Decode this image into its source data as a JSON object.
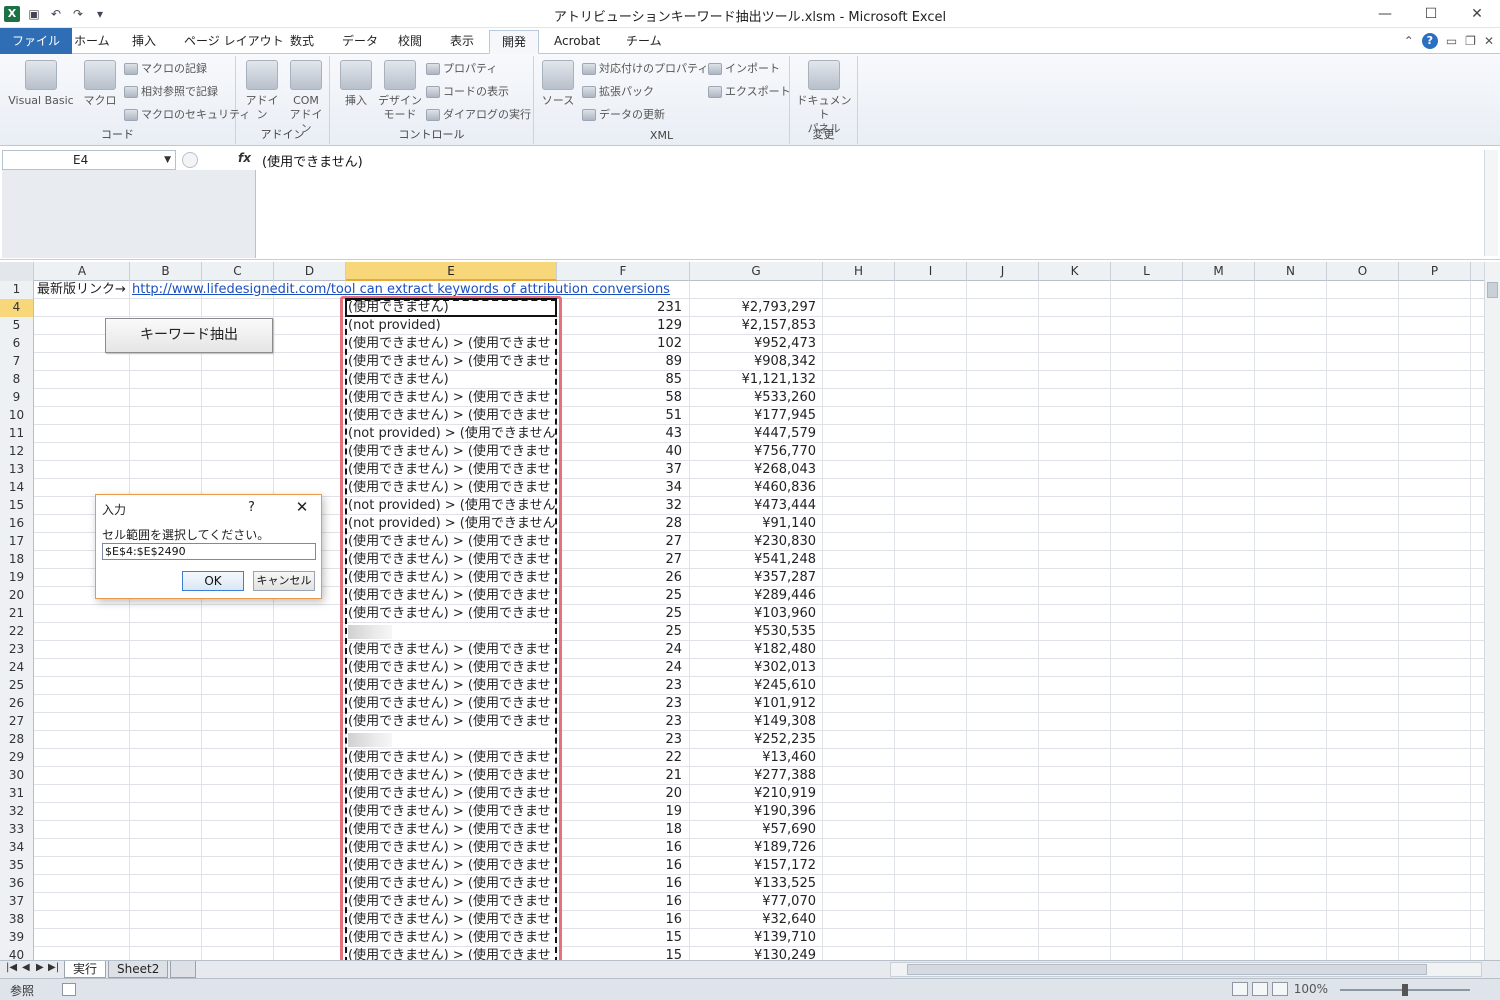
{
  "window": {
    "title": "アトリビューションキーワード抽出ツール.xlsm - Microsoft Excel",
    "minimize": "—",
    "maximize": "☐",
    "close": "✕"
  },
  "qat": {
    "logo": "X",
    "save": "▣",
    "undo": "↶",
    "redo": "↷",
    "customize": "▾"
  },
  "tabs": [
    "ファイル",
    "ホーム",
    "挿入",
    "ページ レイアウト",
    "数式",
    "データ",
    "校閲",
    "表示",
    "開発",
    "Acrobat",
    "チーム"
  ],
  "active_tab": "開発",
  "ribbon": {
    "code": {
      "label": "コード",
      "visual_basic": "Visual Basic",
      "macro": "マクロ",
      "record_macro": "マクロの記録",
      "relative_ref": "相対参照で記録",
      "macro_security": "マクロのセキュリティ"
    },
    "addin": {
      "label": "アドイン",
      "addin": "アドイン",
      "com_addin_1": "COM",
      "com_addin_2": "アドイン"
    },
    "controls": {
      "label": "コントロール",
      "insert": "挿入",
      "design_mode_1": "デザイン",
      "design_mode_2": "モード",
      "properties": "プロパティ",
      "view_code": "コードの表示",
      "run_dialog": "ダイアログの実行"
    },
    "xml": {
      "label": "XML",
      "source": "ソース",
      "map_properties": "対応付けのプロパティ",
      "expansion_packs": "拡張パック",
      "refresh_data": "データの更新",
      "import": "インポート",
      "export": "エクスポート"
    },
    "modify": {
      "label": "変更",
      "doc_panel_1": "ドキュメント",
      "doc_panel_2": "パネル"
    }
  },
  "formula_bar": {
    "name_box": "E4",
    "fx": "fx",
    "content": "(使用できません)"
  },
  "columns": [
    "A",
    "B",
    "C",
    "D",
    "E",
    "F",
    "G",
    "H",
    "I",
    "J",
    "K",
    "L",
    "M",
    "N",
    "O",
    "P"
  ],
  "selected_column": "E",
  "row1": {
    "number": "1",
    "a": "最新版リンク→",
    "link": "http://www.lifedesignedit.com/tool can extract keywords of attribution conversions"
  },
  "keyword_button": "キーワード抽出",
  "rows": [
    {
      "n": "4",
      "e": "(使用できません)",
      "f": "231",
      "g": "¥2,793,297"
    },
    {
      "n": "5",
      "e": "(not provided)",
      "f": "129",
      "g": "¥2,157,853"
    },
    {
      "n": "6",
      "e": "(使用できません) > (使用できませ",
      "f": "102",
      "g": "¥952,473"
    },
    {
      "n": "7",
      "e": "(使用できません) > (使用できませ",
      "f": "89",
      "g": "¥908,342"
    },
    {
      "n": "8",
      "e": "(使用できません)",
      "f": "85",
      "g": "¥1,121,132"
    },
    {
      "n": "9",
      "e": "(使用できません) > (使用できませ",
      "f": "58",
      "g": "¥533,260"
    },
    {
      "n": "10",
      "e": "(使用できません) > (使用できませ",
      "f": "51",
      "g": "¥177,945"
    },
    {
      "n": "11",
      "e": "(not provided) > (使用できません",
      "f": "43",
      "g": "¥447,579"
    },
    {
      "n": "12",
      "e": "(使用できません) > (使用できませ",
      "f": "40",
      "g": "¥756,770"
    },
    {
      "n": "13",
      "e": "(使用できません) > (使用できませ",
      "f": "37",
      "g": "¥268,043"
    },
    {
      "n": "14",
      "e": "(使用できません) > (使用できませ",
      "f": "34",
      "g": "¥460,836"
    },
    {
      "n": "15",
      "e": "(not provided) > (使用できません",
      "f": "32",
      "g": "¥473,444"
    },
    {
      "n": "16",
      "e": "(not provided) > (使用できません",
      "f": "28",
      "g": "¥91,140"
    },
    {
      "n": "17",
      "e": "(使用できません) > (使用できませ",
      "f": "27",
      "g": "¥230,830"
    },
    {
      "n": "18",
      "e": "(使用できません) > (使用できませ",
      "f": "27",
      "g": "¥541,248"
    },
    {
      "n": "19",
      "e": "(使用できません) > (使用できませ",
      "f": "26",
      "g": "¥357,287"
    },
    {
      "n": "20",
      "e": "(使用できません) > (使用できませ",
      "f": "25",
      "g": "¥289,446"
    },
    {
      "n": "21",
      "e": "(使用できません) > (使用できませ",
      "f": "25",
      "g": "¥103,960"
    },
    {
      "n": "22",
      "e": "",
      "f": "25",
      "g": "¥530,535"
    },
    {
      "n": "23",
      "e": "(使用できません) > (使用できませ",
      "f": "24",
      "g": "¥182,480"
    },
    {
      "n": "24",
      "e": "(使用できません) > (使用できませ",
      "f": "24",
      "g": "¥302,013"
    },
    {
      "n": "25",
      "e": "(使用できません) > (使用できませ",
      "f": "23",
      "g": "¥245,610"
    },
    {
      "n": "26",
      "e": "(使用できません) > (使用できませ",
      "f": "23",
      "g": "¥101,912"
    },
    {
      "n": "27",
      "e": "(使用できません) > (使用できませ",
      "f": "23",
      "g": "¥149,308"
    },
    {
      "n": "28",
      "e": "",
      "f": "23",
      "g": "¥252,235"
    },
    {
      "n": "29",
      "e": "(使用できません) > (使用できませ",
      "f": "22",
      "g": "¥13,460"
    },
    {
      "n": "30",
      "e": "(使用できません) > (使用できませ",
      "f": "21",
      "g": "¥277,388"
    },
    {
      "n": "31",
      "e": "(使用できません) > (使用できませ",
      "f": "20",
      "g": "¥210,919"
    },
    {
      "n": "32",
      "e": "(使用できません) > (使用できませ",
      "f": "19",
      "g": "¥190,396"
    },
    {
      "n": "33",
      "e": "(使用できません) > (使用できませ",
      "f": "18",
      "g": "¥57,690"
    },
    {
      "n": "34",
      "e": "(使用できません) > (使用できませ",
      "f": "16",
      "g": "¥189,726"
    },
    {
      "n": "35",
      "e": "(使用できません) > (使用できませ",
      "f": "16",
      "g": "¥157,172"
    },
    {
      "n": "36",
      "e": "(使用できません) > (使用できませ",
      "f": "16",
      "g": "¥133,525"
    },
    {
      "n": "37",
      "e": "(使用できません) > (使用できませ",
      "f": "16",
      "g": "¥77,070"
    },
    {
      "n": "38",
      "e": "(使用できません) > (使用できませ",
      "f": "16",
      "g": "¥32,640"
    },
    {
      "n": "39",
      "e": "(使用できません) > (使用できませ",
      "f": "15",
      "g": "¥139,710"
    },
    {
      "n": "40",
      "e": "(使用できません) > (使用できませ",
      "f": "15",
      "g": "¥130,249"
    }
  ],
  "dialog": {
    "title": "入力",
    "help": "?",
    "close": "✕",
    "prompt": "セル範囲を選択してください。",
    "value": "$E$4:$E$2490",
    "ok": "OK",
    "cancel": "キャンセル"
  },
  "sheets": [
    "実行",
    "Sheet2"
  ],
  "active_sheet": "実行",
  "status": {
    "mode": "参照",
    "zoom": "100%"
  }
}
